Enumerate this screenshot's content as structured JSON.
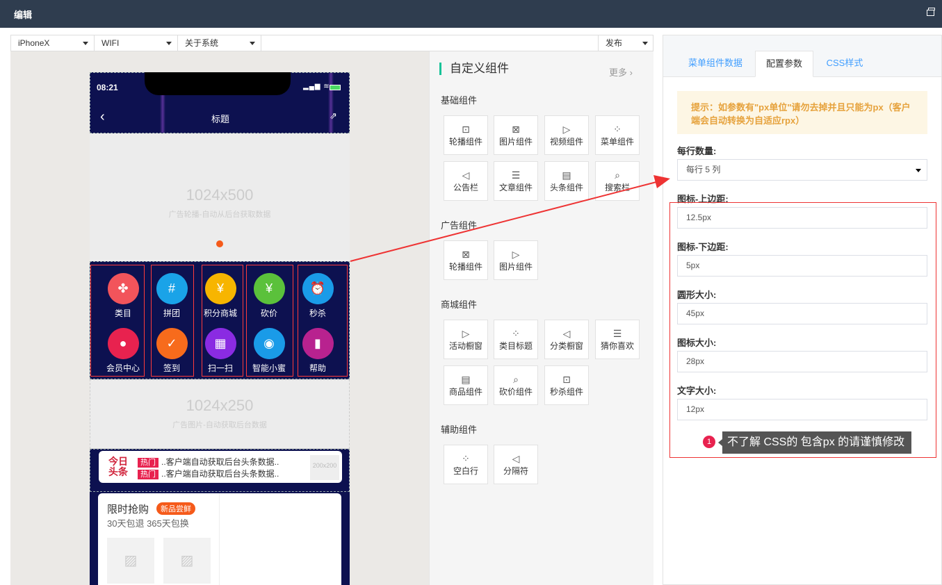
{
  "window": {
    "title": "编辑"
  },
  "toolbar": {
    "device": "iPhoneX",
    "network": "WIFI",
    "page": "关于系统",
    "publish": "发布"
  },
  "phone": {
    "time": "08:21",
    "title": "标题",
    "banner1": {
      "size": "1024x500",
      "caption": "广告轮播-自动从后台获取数据"
    },
    "menu": [
      {
        "label": "类目",
        "icon": "✤",
        "color": "#f2545b"
      },
      {
        "label": "拼团",
        "icon": "#",
        "color": "#1aa3e8"
      },
      {
        "label": "积分商城",
        "icon": "¥",
        "color": "#f7b500"
      },
      {
        "label": "砍价",
        "icon": "¥",
        "color": "#5bc13b"
      },
      {
        "label": "秒杀",
        "icon": "⏰",
        "color": "#1a9be8"
      },
      {
        "label": "会员中心",
        "icon": "●",
        "color": "#e8224f"
      },
      {
        "label": "签到",
        "icon": "✓",
        "color": "#f76b1c"
      },
      {
        "label": "扫一扫",
        "icon": "▦",
        "color": "#8a2be2"
      },
      {
        "label": "智能小蜜",
        "icon": "◉",
        "color": "#1a9be8"
      },
      {
        "label": "帮助",
        "icon": "▮",
        "color": "#b8228f"
      }
    ],
    "banner2": {
      "size": "1024x250",
      "caption": "广告图片-自动获取后台数据"
    },
    "news": {
      "logo1": "今日",
      "logo2": "头条",
      "tag": "热门",
      "line1": "..客户端自动获取后台头条数据..",
      "line2": "..客户端自动获取后台头条数据..",
      "thumb": "200x200"
    },
    "flash": {
      "title": "限时抢购",
      "badge": "新品尝鲜",
      "sub": "30天包退 365天包换"
    }
  },
  "components": {
    "header": "自定义组件",
    "more": "更多",
    "groups": [
      {
        "name": "基础组件",
        "items": [
          "轮播组件",
          "图片组件",
          "视频组件",
          "菜单组件",
          "公告栏",
          "文章组件",
          "头条组件",
          "搜索栏"
        ]
      },
      {
        "name": "广告组件",
        "items": [
          "轮播组件",
          "图片组件"
        ]
      },
      {
        "name": "商城组件",
        "items": [
          "活动橱窗",
          "类目标题",
          "分类橱窗",
          "猜你喜欢",
          "商品组件",
          "砍价组件",
          "秒杀组件"
        ]
      },
      {
        "name": "辅助组件",
        "items": [
          "空白行",
          "分隔符"
        ]
      }
    ]
  },
  "panel": {
    "tabs": [
      "菜单组件数据",
      "配置参数",
      "CSS样式"
    ],
    "tip": "提示：如参数有\"px单位\"请勿去掉并且只能为px（客户端会自动转换为自适应rpx）",
    "fields": [
      {
        "label": "每行数量:",
        "value": "每行 5 列"
      },
      {
        "label": "图标-上边距:",
        "value": "12.5px"
      },
      {
        "label": "图标-下边距:",
        "value": "5px"
      },
      {
        "label": "圆形大小:",
        "value": "45px"
      },
      {
        "label": "图标大小:",
        "value": "28px"
      },
      {
        "label": "文字大小:",
        "value": "12px"
      }
    ],
    "note_num": "1",
    "note": "不了解 CSS的 包含px 的请谨慎修改"
  }
}
